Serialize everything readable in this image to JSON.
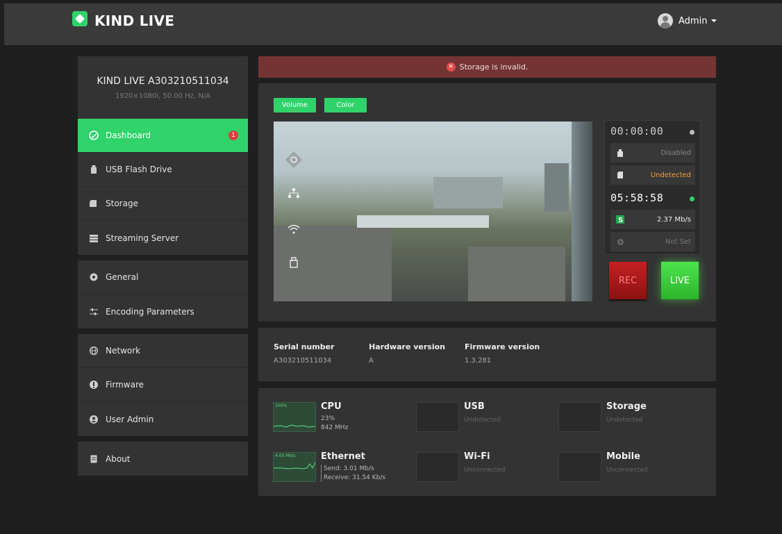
{
  "header": {
    "brand": "KIND LIVE",
    "user": "Admin"
  },
  "device": {
    "name": "KIND LIVE A303210511034",
    "signal": "1920×1080i, 50.00 Hz, N/A"
  },
  "sidebar": {
    "groups": [
      [
        {
          "label": "Dashboard",
          "icon": "gauge-icon",
          "active": true,
          "badge": "1"
        },
        {
          "label": "USB Flash Drive",
          "icon": "usb-icon"
        },
        {
          "label": "Storage",
          "icon": "sd-card-icon"
        },
        {
          "label": "Streaming Server",
          "icon": "server-icon"
        }
      ],
      [
        {
          "label": "General",
          "icon": "gear-icon"
        },
        {
          "label": "Encoding Parameters",
          "icon": "sliders-icon"
        }
      ],
      [
        {
          "label": "Network",
          "icon": "globe-icon"
        },
        {
          "label": "Firmware",
          "icon": "firmware-icon"
        },
        {
          "label": "User Admin",
          "icon": "user-icon"
        }
      ],
      [
        {
          "label": "About",
          "icon": "document-icon"
        }
      ]
    ]
  },
  "alert": {
    "message": "Storage is invalid.",
    "icon": "error-icon"
  },
  "preview": {
    "volume_label": "Volume",
    "color_label": "Color",
    "overlay_icons": [
      "camera-icon",
      "network-icon",
      "wifi-icon",
      "usb-icon"
    ]
  },
  "status": {
    "record_time": "00:00:00",
    "usb_status": "Disabled",
    "storage_status": "Undetected",
    "stream_time": "05:58:58",
    "stream_rate": "2.37 Mb/s",
    "server_status": "Not Set",
    "colors": {
      "idle": "#bdbdbd",
      "live": "#2fd36a",
      "warning": "#f0a040"
    }
  },
  "actions": {
    "rec_label": "REC",
    "live_label": "LIVE"
  },
  "info": {
    "serial_label": "Serial number",
    "serial_value": "A303210511034",
    "hardware_label": "Hardware version",
    "hardware_value": "A",
    "firmware_label": "Firmware version",
    "firmware_value": "1.3.281"
  },
  "monitors": {
    "cpu": {
      "tag": "100%",
      "title": "CPU",
      "usage": "23%",
      "freq": "842 MHz"
    },
    "usb": {
      "title": "USB",
      "status": "Undetected"
    },
    "storage": {
      "title": "Storage",
      "status": "Undetected"
    },
    "ethernet": {
      "tag": "4.00 Mb/s",
      "title": "Ethernet",
      "send": "Send: 3.01 Mb/s",
      "receive": "Receive: 31.54 Kb/s"
    },
    "wifi": {
      "title": "Wi-Fi",
      "status": "Unconnected"
    },
    "mobile": {
      "title": "Mobile",
      "status": "Unconnected"
    }
  },
  "theme": {
    "accent": "#2fd36a",
    "alert_bg": "#743434",
    "panel": "#333333"
  }
}
